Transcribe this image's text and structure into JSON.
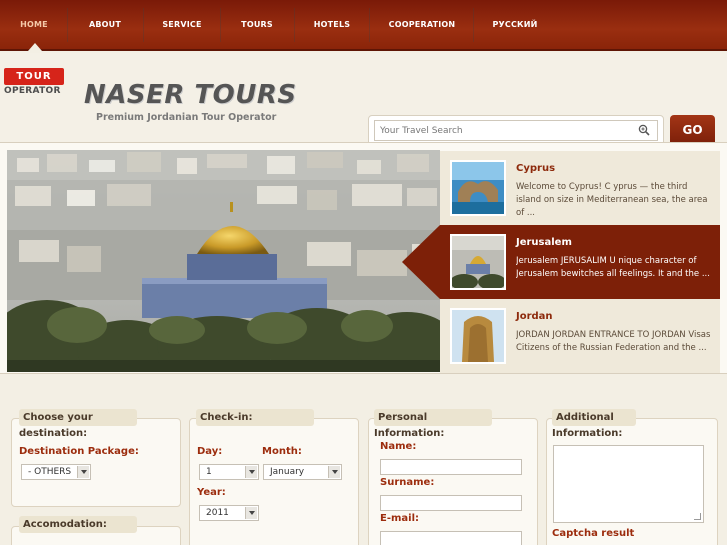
{
  "nav": {
    "items": [
      {
        "label": "HOME",
        "active": true
      },
      {
        "label": "ABOUT"
      },
      {
        "label": "SERVICE"
      },
      {
        "label": "TOURS"
      },
      {
        "label": "HOTELS"
      },
      {
        "label": "COOPERATION"
      },
      {
        "label": "РУССКИЙ"
      }
    ]
  },
  "header": {
    "badge_top": "TOUR",
    "badge_bottom": "OPERATOR",
    "title": "NASER TOURS",
    "subtitle": "Premium Jordanian Tour Operator"
  },
  "search": {
    "placeholder": "Your Travel Search",
    "go_label": "GO"
  },
  "slider": {
    "items": [
      {
        "title": "Cyprus",
        "desc": "Welcome to Cyprus!   C yprus  — the third island on size in Mediterranean sea, the area of ..."
      },
      {
        "title": "Jerusalem",
        "desc": "Jerusalem   JERUSALIM U nique character of Jerusalem bewitches all feelings. It and the ..."
      },
      {
        "title": "Jordan",
        "desc": "JORDAN   JORDAN ENTRANCE TO JORDAN Visas Citizens of the Russian Federation and the ..."
      }
    ]
  },
  "form": {
    "destination": {
      "heading": "Choose your",
      "heading_cont": "destination:",
      "package_label": "Destination Package:",
      "package_value": "- OTHERS"
    },
    "accommodation": {
      "heading": "Accomodation:"
    },
    "checkin": {
      "heading": "Check-in:",
      "day_label": "Day:",
      "day_value": "1",
      "month_label": "Month:",
      "month_value": "January",
      "year_label": "Year:",
      "year_value": "2011"
    },
    "personal": {
      "heading": "Personal",
      "heading_cont": "Information:",
      "name_label": "Name:",
      "surname_label": "Surname:",
      "email_label": "E-mail:"
    },
    "additional": {
      "heading": "Additional",
      "heading_cont": "Information:",
      "captcha_label": "Captcha result"
    }
  },
  "colors": {
    "brand": "#8a2409",
    "accent": "#9c2c0d",
    "badge": "#d6241a"
  }
}
